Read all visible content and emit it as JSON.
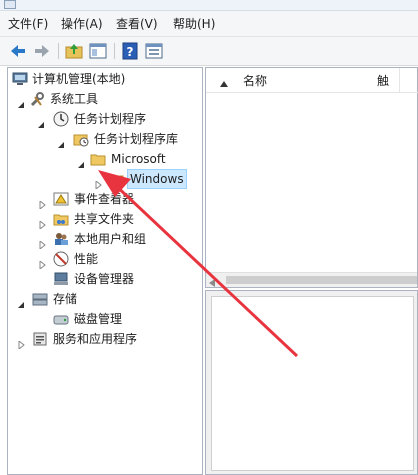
{
  "menu": [
    "文件(F)",
    "操作(A)",
    "查看(V)",
    "帮助(H)"
  ],
  "toolbar_icons": [
    "back-icon",
    "forward-icon",
    "up-folder-icon",
    "show-hide-tree-icon",
    "help-icon",
    "properties-icon"
  ],
  "tree": {
    "root": "计算机管理(本地)",
    "system_tools": "系统工具",
    "task_scheduler": "任务计划程序",
    "task_library": "任务计划程序库",
    "microsoft": "Microsoft",
    "windows": "Windows",
    "event_viewer": "事件查看器",
    "shared_folders": "共享文件夹",
    "local_users": "本地用户和组",
    "performance": "性能",
    "device_manager": "设备管理器",
    "storage": "存储",
    "disk_management": "磁盘管理",
    "services": "服务和应用程序"
  },
  "list": {
    "col_name": "名称",
    "col_status": "触"
  },
  "annotation": {
    "arrow_color": "#e8343f"
  }
}
